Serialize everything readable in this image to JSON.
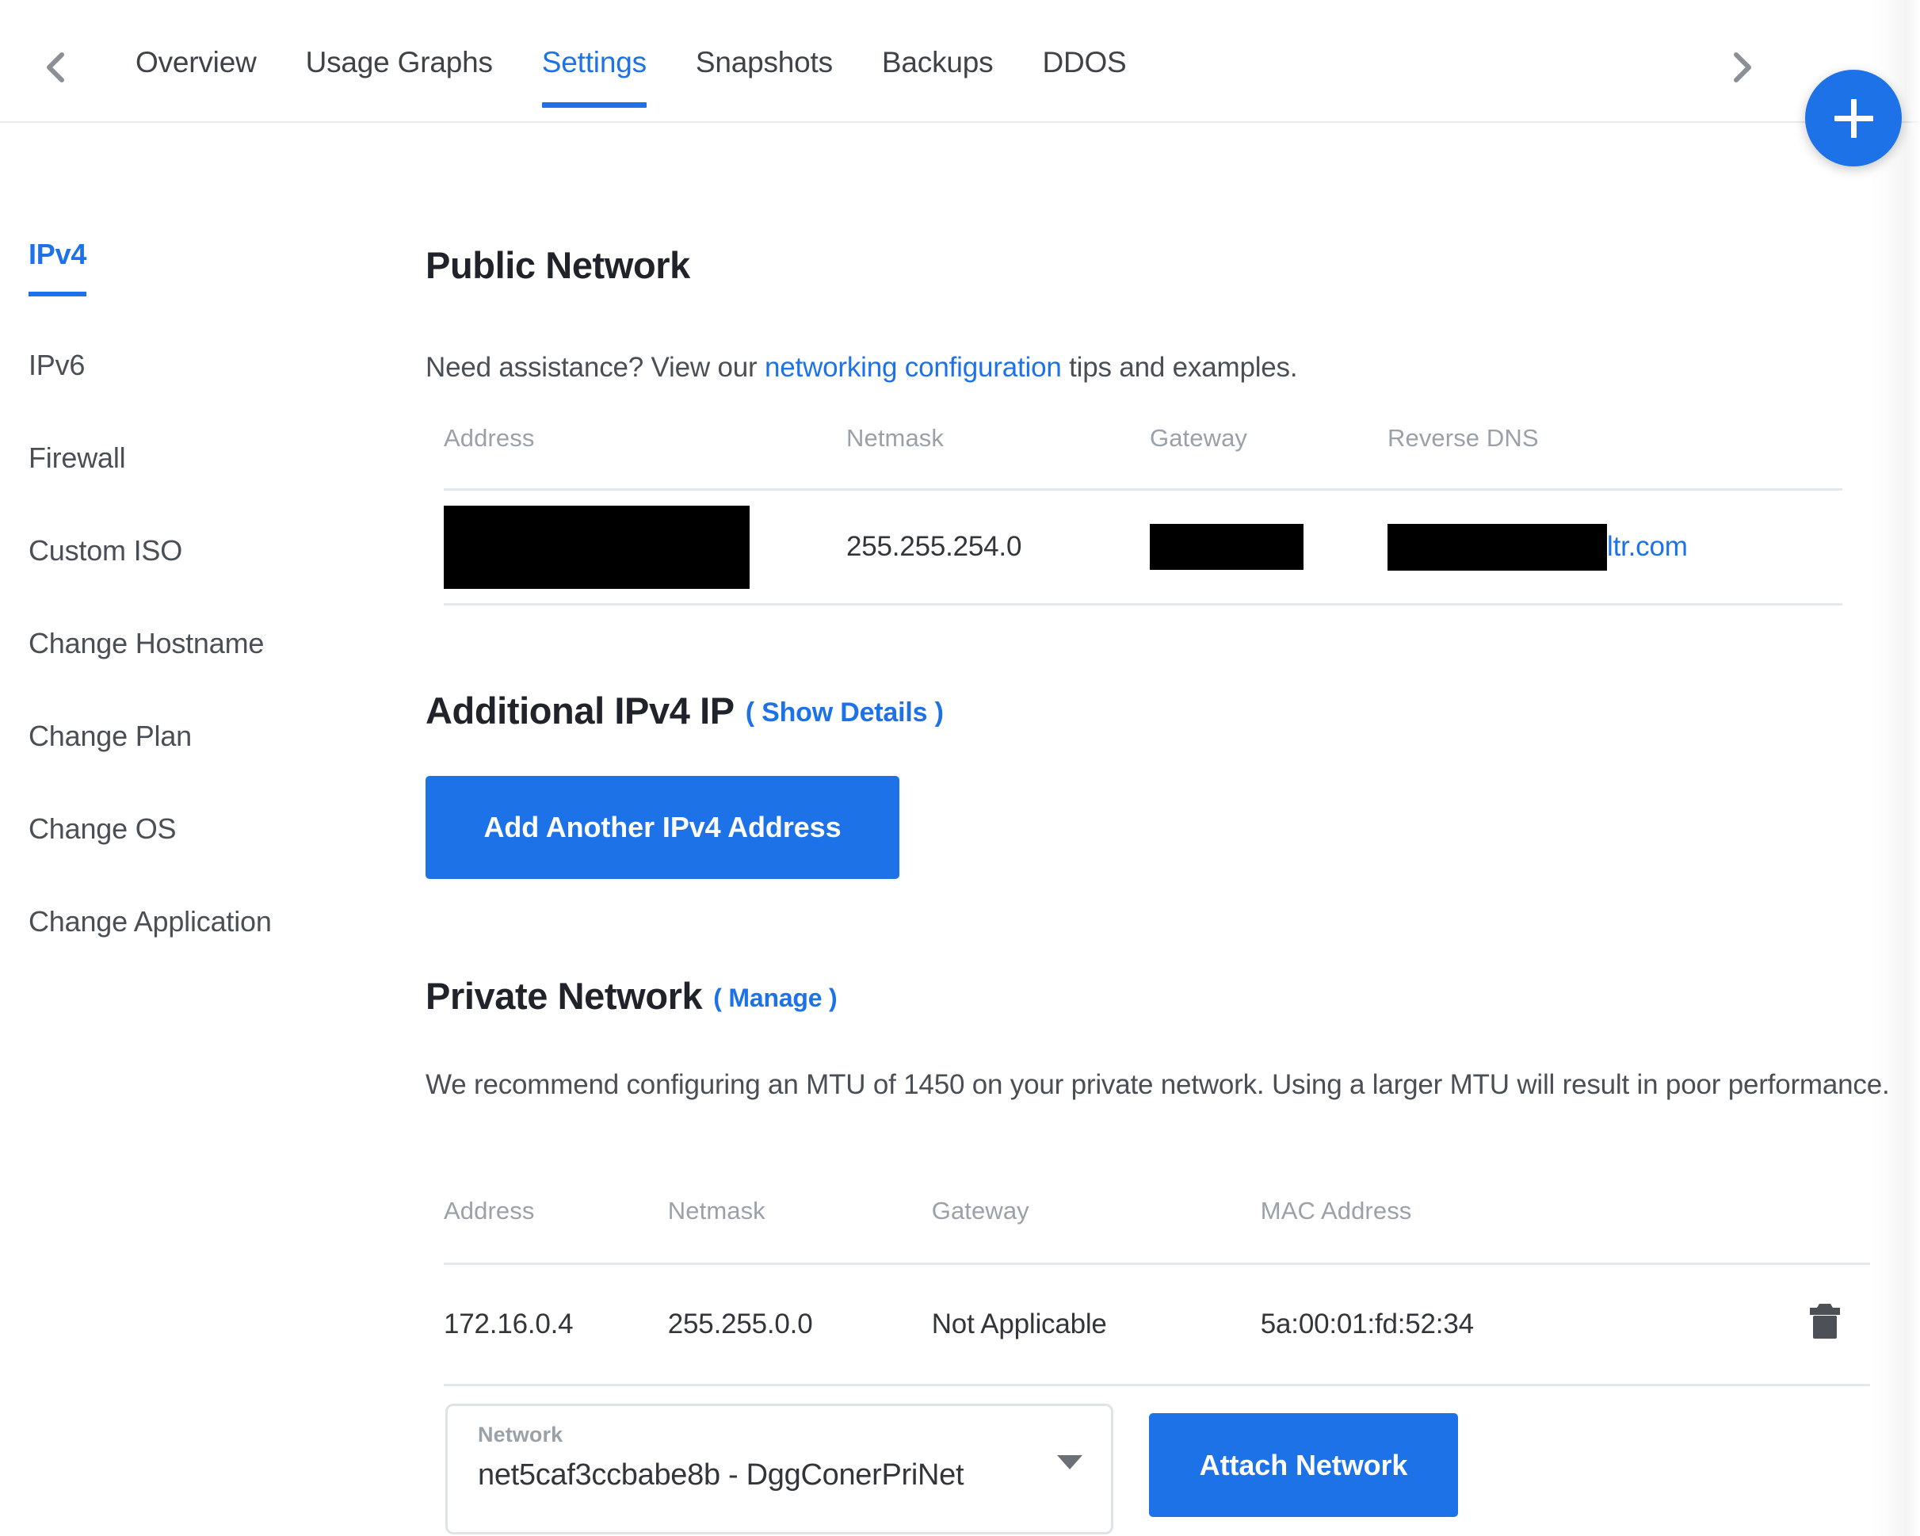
{
  "colors": {
    "accent": "#1d72e8",
    "text": "#32363b",
    "muted": "#9ba1a8",
    "rule": "#e3e8ee",
    "redaction": "#000000"
  },
  "tabbar": {
    "prev_icon": "chevron-left-icon",
    "next_icon": "chevron-right-icon",
    "tabs": [
      {
        "label": "Overview",
        "active": false
      },
      {
        "label": "Usage Graphs",
        "active": false
      },
      {
        "label": "Settings",
        "active": true
      },
      {
        "label": "Snapshots",
        "active": false
      },
      {
        "label": "Backups",
        "active": false
      },
      {
        "label": "DDOS",
        "active": false
      }
    ]
  },
  "fab": {
    "icon": "plus-icon",
    "label": "+"
  },
  "sidebar": {
    "items": [
      {
        "label": "IPv4",
        "active": true
      },
      {
        "label": "IPv6",
        "active": false
      },
      {
        "label": "Firewall",
        "active": false
      },
      {
        "label": "Custom ISO",
        "active": false
      },
      {
        "label": "Change Hostname",
        "active": false
      },
      {
        "label": "Change Plan",
        "active": false
      },
      {
        "label": "Change OS",
        "active": false
      },
      {
        "label": "Change Application",
        "active": false
      }
    ]
  },
  "public_network": {
    "heading": "Public Network",
    "assistance_prefix": "Need assistance? View our ",
    "assistance_link": "networking configuration",
    "assistance_suffix": " tips and examples.",
    "headers": [
      "Address",
      "Netmask",
      "Gateway",
      "Reverse DNS"
    ],
    "row": {
      "address": "",
      "address_redacted": true,
      "netmask": "255.255.254.0",
      "gateway": "",
      "gateway_redacted": true,
      "reverse_dns_redacted": true,
      "reverse_dns_visible": "ltr.com"
    }
  },
  "additional_ipv4": {
    "heading": "Additional IPv4 IP",
    "show_details_link": "( Show Details )",
    "add_button": "Add Another IPv4 Address"
  },
  "private_network": {
    "heading": "Private Network",
    "manage_link": "( Manage )",
    "description": "We recommend configuring an MTU of 1450 on your private network. Using a larger MTU will result in poor performance.",
    "headers": [
      "Address",
      "Netmask",
      "Gateway",
      "MAC Address"
    ],
    "rows": [
      {
        "address": "172.16.0.4",
        "netmask": "255.255.0.0",
        "gateway": "Not Applicable",
        "mac_address": "5a:00:01:fd:52:34",
        "delete_icon": "trash-icon"
      }
    ],
    "network_select": {
      "label": "Network",
      "value": "net5caf3ccbabe8b - DggConerPriNet",
      "caret_icon": "chevron-down-icon"
    },
    "attach_button": "Attach Network"
  }
}
